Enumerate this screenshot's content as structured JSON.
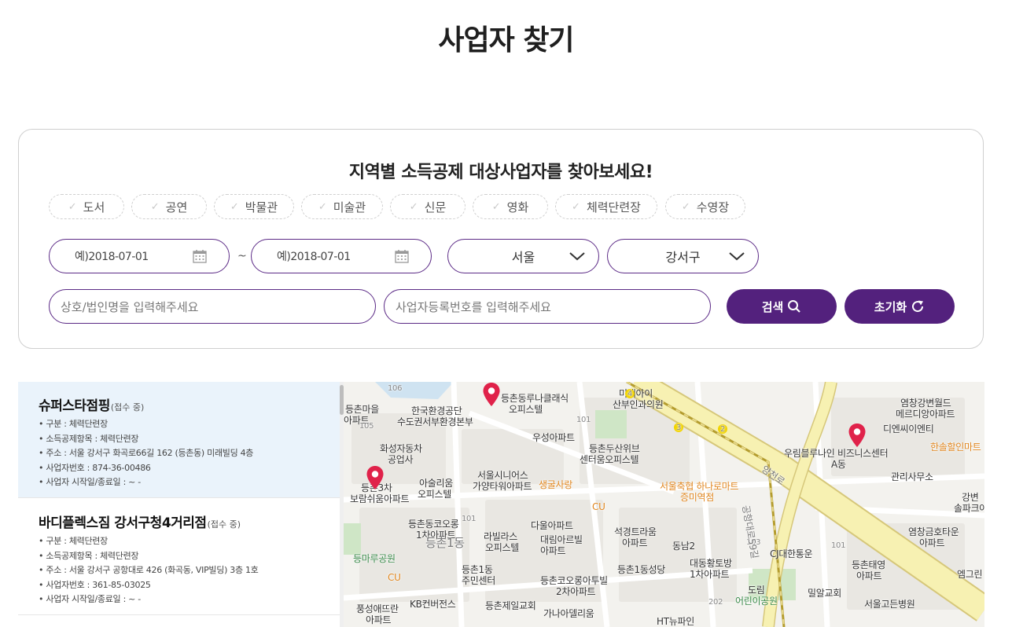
{
  "page": {
    "title": "사업자 찾기"
  },
  "search": {
    "heading": "지역별 소득공제 대상사업자를 찾아보세요!",
    "categories": [
      "도서",
      "공연",
      "박물관",
      "미술관",
      "신문",
      "영화",
      "체력단련장",
      "수영장"
    ],
    "date_from": "예)2018-07-01",
    "date_separator": "~",
    "date_to": "예)2018-07-01",
    "city": "서울",
    "district": "강서구",
    "name_placeholder": "상호/법인명을 입력해주세요",
    "regno_placeholder": "사업자등록번호를 입력해주세요",
    "search_label": "검색",
    "reset_label": "초기화"
  },
  "results": [
    {
      "name": "슈퍼스타점핑",
      "status": "(접수 중)",
      "type": "• 구분 : 체력단련장",
      "item": "• 소득공제항목 : 체력단련장",
      "address": "• 주소 : 서울 강서구 화곡로66길 162 (등촌동) 미래빌딩 4층",
      "regno": "• 사업자번호 : 874-36-00486",
      "period": "• 사업자 시작일/종료일 :  ~ -"
    },
    {
      "name": "바디플렉스짐 강서구청4거리점",
      "status": "(접수 중)",
      "type": "• 구분 : 체력단련장",
      "item": "• 소득공제항목 : 체력단련장",
      "address": "• 주소 : 서울 강서구 공항대로 426 (화곡동, VIP빌딩) 3층 1호",
      "regno": "• 사업자번호 : 361-85-03025",
      "period": "• 사업자 시작일/종료일 :  ~ -"
    }
  ],
  "map": {
    "labels": [
      "106",
      "등촌마을",
      "아파트",
      "105",
      "한국환경공단",
      "수도권서부환경본부",
      "등촌동루나클래식",
      "오피스텔",
      "미래아이",
      "산부인과의원",
      "101",
      "4",
      "우성아파트",
      "화성자동차",
      "공업사",
      "3",
      "2",
      "등촌두산위브",
      "센터움오피스텔",
      "서울시니어스",
      "가양타워아파트",
      "아술리움",
      "오피스텔",
      "생굴사랑",
      "서울축협 하나로마트",
      "증미역점",
      "디엔씨이엔티",
      "우림블루나인 비즈니스센터",
      "A동",
      "관리사무소",
      "염창강변월드",
      "메르디앙아파트",
      "한솔할인마트",
      "등촌3차",
      "보람쉬움아파트",
      "CU",
      "등촌동코오롱",
      "1차아파트",
      "101",
      "다울아파트",
      "라빌라스",
      "오피스텔",
      "등촌1동",
      "대림아르빌",
      "아파트",
      "석경트라움",
      "아파트",
      "동남2",
      "103",
      "CJ대한통운",
      "101",
      "염창금호타운",
      "아파트",
      "강변",
      "솔파크아",
      "등마루공원",
      "등촌1동",
      "주민센터",
      "등촌코오롱아투빌",
      "2차아파트",
      "등촌1동성당",
      "대동황토방",
      "1차아파트",
      "등촌태영",
      "아파트",
      "엠그린",
      "CU",
      "KB컨버전스",
      "등촌제일교회",
      "도림",
      "어린이공원",
      "밀알교회",
      "서울고든병원",
      "풍성애뜨란",
      "아파트",
      "가나아델리움",
      "202",
      "HT뉴파인",
      "공항대로59길",
      "양천로"
    ]
  }
}
